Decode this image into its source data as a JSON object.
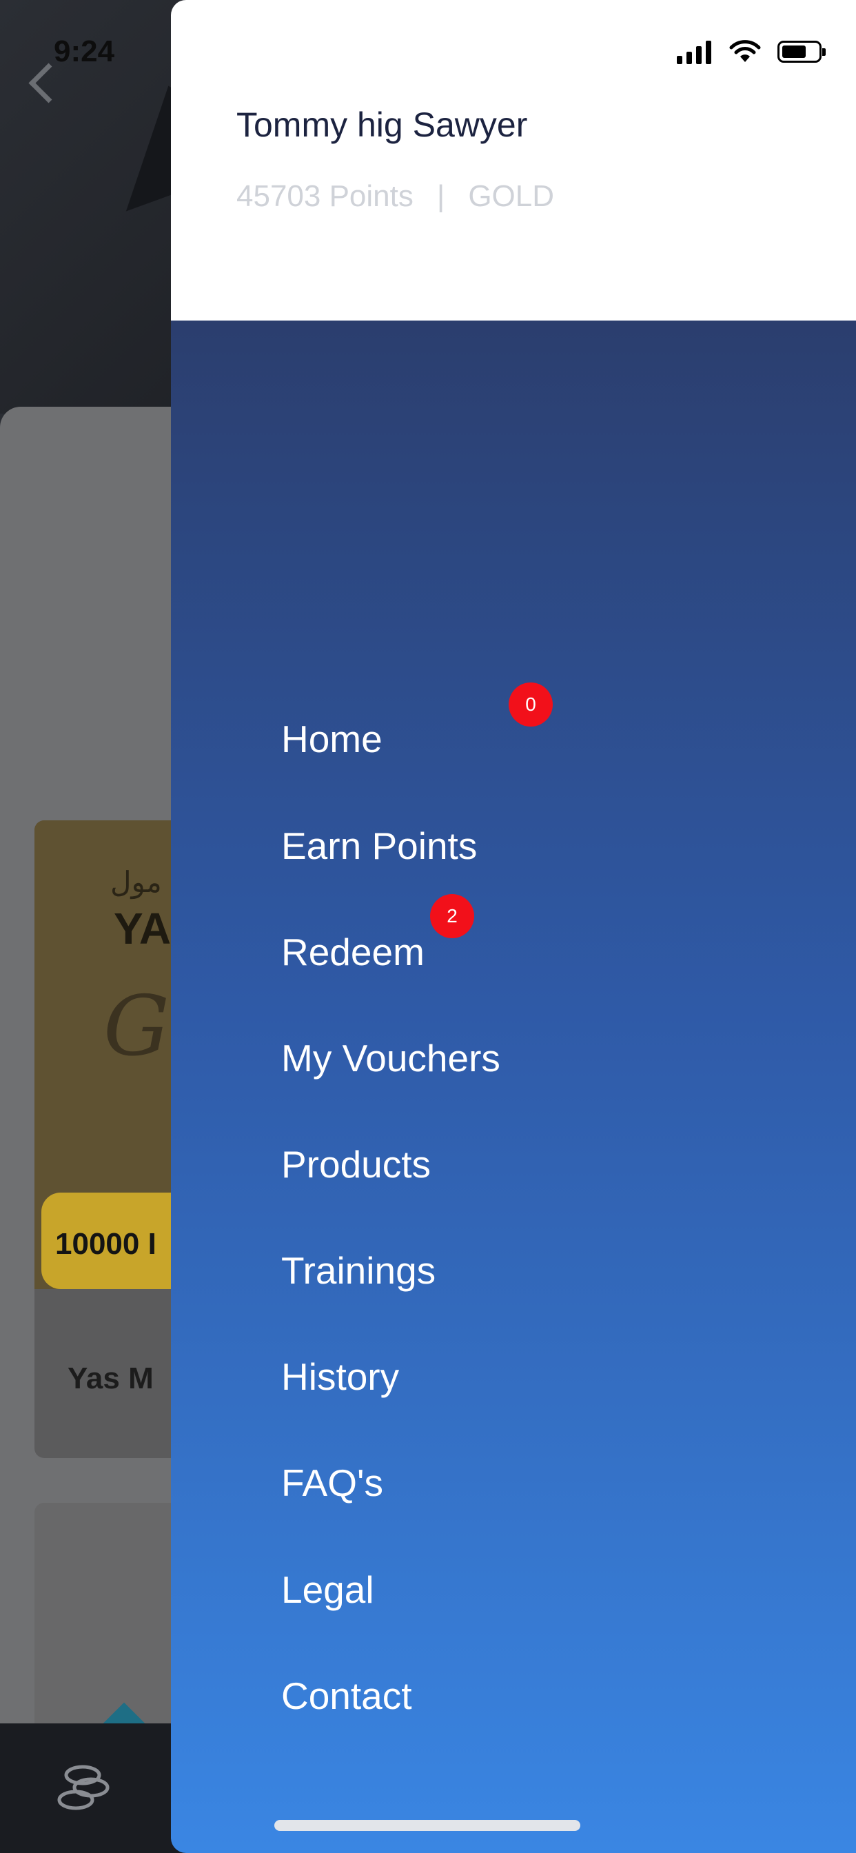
{
  "status_bar": {
    "time": "9:24",
    "icons": [
      "location-arrow-icon",
      "signal-icon",
      "wifi-icon",
      "battery-icon"
    ]
  },
  "background": {
    "card_points": "10000 I",
    "card_name": "Yas M",
    "card_logo_text": "YA",
    "card_logo_arabic": "مول"
  },
  "drawer": {
    "user_name": "Tommy hig Sawyer",
    "points": "45703 Points",
    "separator": "|",
    "tier": "GOLD",
    "menu": [
      {
        "label": "Home"
      },
      {
        "label": "Earn Points"
      },
      {
        "label": "Redeem"
      },
      {
        "label": "My Vouchers",
        "badge": "0"
      },
      {
        "label": "Products"
      },
      {
        "label": "Trainings",
        "badge": "2"
      },
      {
        "label": "History"
      },
      {
        "label": "FAQ's"
      },
      {
        "label": "Legal"
      },
      {
        "label": "Contact"
      }
    ]
  },
  "colors": {
    "drawer_gradient_top": "#2b3e6e",
    "drawer_gradient_bottom": "#3a86e3",
    "badge": "#f2101a",
    "name_text": "#1c2340",
    "meta_text": "#cfd2d8"
  }
}
